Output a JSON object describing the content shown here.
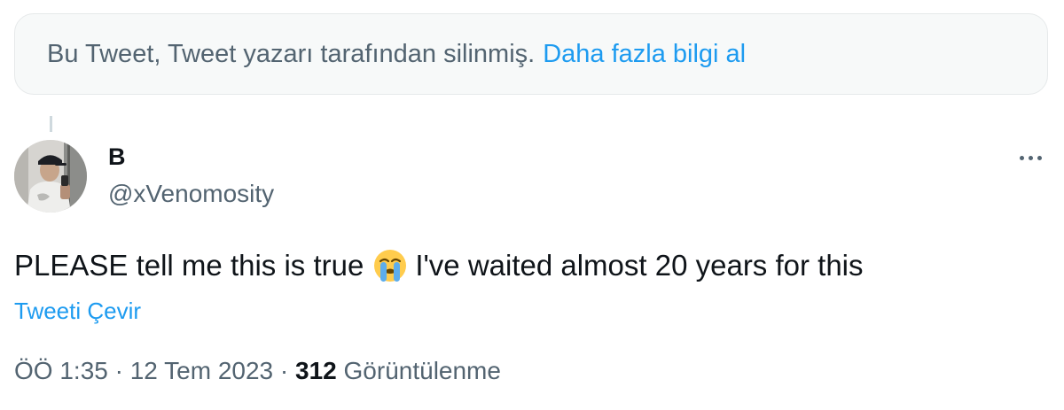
{
  "deleted_notice": {
    "text": "Bu Tweet, Tweet yazarı tarafından silinmiş.",
    "link": "Daha fazla bilgi al"
  },
  "author": {
    "display_name": "B",
    "handle": "@xVenomosity"
  },
  "tweet": {
    "text_before_emoji": "PLEASE tell me this is true",
    "emoji": "loudly-crying-face-icon",
    "text_after_emoji": "I've waited almost 20 years for this",
    "translate_label": "Tweeti Çevir"
  },
  "meta": {
    "time": "ÖÖ 1:35",
    "separator": "·",
    "date": "12 Tem 2023",
    "views_count": "312",
    "views_label": "Görüntülenme"
  },
  "colors": {
    "accent": "#1d9bf0",
    "secondary_text": "#536471",
    "primary_text": "#0f1419",
    "notice_background": "#f7f9f9"
  }
}
